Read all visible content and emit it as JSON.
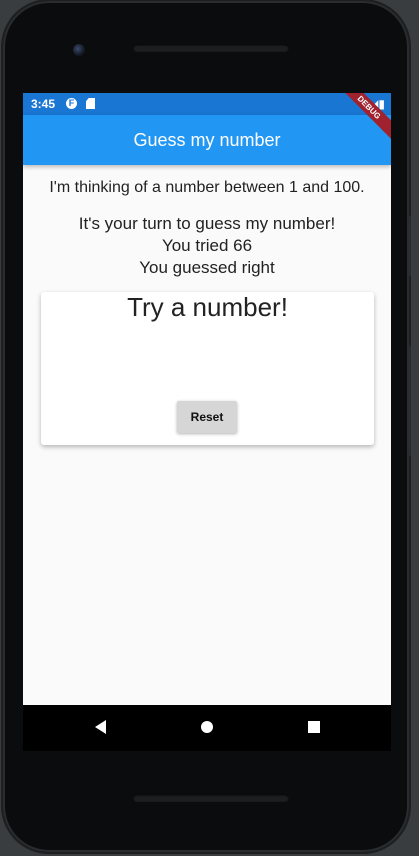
{
  "status_bar": {
    "time": "3:45",
    "right_icons": "▾◢▮"
  },
  "app_bar": {
    "title": "Guess my number"
  },
  "debug_banner": "DEBUG",
  "body": {
    "intro": "I'm thinking of a number between 1 and 100.",
    "turn_prompt": "It's your turn to guess my number!",
    "tried": "You tried 66",
    "result": "You guessed right"
  },
  "card": {
    "title": "Try a number!",
    "reset_label": "Reset"
  },
  "colors": {
    "primary": "#2196f3",
    "primary_dark": "#1976d2",
    "background": "#fafafa",
    "button_grey": "#d6d6d6",
    "debug_red": "#a0222e"
  },
  "icons": {
    "nav_back": "back-triangle-icon",
    "nav_home": "home-circle-icon",
    "nav_recent": "recent-apps-square-icon"
  }
}
